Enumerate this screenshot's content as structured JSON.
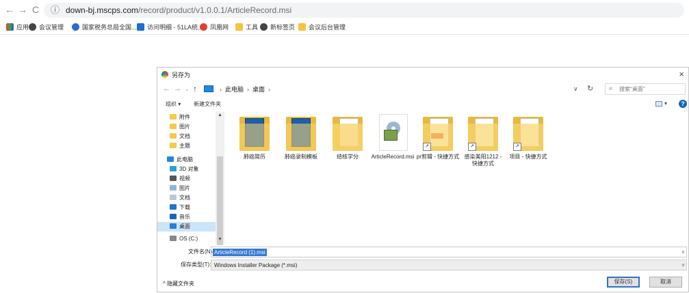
{
  "browser": {
    "back": "←",
    "forward": "→",
    "reload": "C",
    "info_icon": "ⓘ",
    "url_host": "down-bj.mscps.com",
    "url_path": "/record/product/v1.0.0.1/ArticleRecord.msi",
    "bookmarks": [
      {
        "label": "应用",
        "icon": "apps-icon"
      },
      {
        "label": "会议管理",
        "icon": "chrome-icon"
      },
      {
        "label": "国家税务总局全国...",
        "icon": "search-icon"
      },
      {
        "label": "访问明细 - 51LA统...",
        "icon": "analytics-icon"
      },
      {
        "label": "凤凰网",
        "icon": "phoenix-icon"
      },
      {
        "label": "工具",
        "icon": "folder-icon"
      },
      {
        "label": "新标签页",
        "icon": "chrome-icon"
      },
      {
        "label": "会议后台管理",
        "icon": "folder-icon"
      }
    ]
  },
  "dialog": {
    "title": "另存为",
    "close": "×",
    "path": {
      "root": "此电脑",
      "current": "桌面"
    },
    "search_placeholder": "搜索\"桌面\"",
    "toolbar": {
      "organize": "组织 ▾",
      "new_folder": "新建文件夹",
      "help": "?"
    },
    "nav": [
      {
        "label": "附件",
        "icon": "folder-icon"
      },
      {
        "label": "图片",
        "icon": "folder-icon"
      },
      {
        "label": "文档",
        "icon": "folder-icon"
      },
      {
        "label": "主题",
        "icon": "folder-icon"
      },
      {
        "label": "此电脑",
        "icon": "computer-icon"
      },
      {
        "label": "3D 对象",
        "icon": "cube-icon"
      },
      {
        "label": "视频",
        "icon": "video-icon"
      },
      {
        "label": "图片",
        "icon": "picture-icon"
      },
      {
        "label": "文档",
        "icon": "document-icon"
      },
      {
        "label": "下载",
        "icon": "download-icon"
      },
      {
        "label": "音乐",
        "icon": "music-icon"
      },
      {
        "label": "桌面",
        "icon": "desktop-icon",
        "selected": true
      },
      {
        "label": "OS (C:)",
        "icon": "drive-icon"
      }
    ],
    "files": [
      {
        "label": "肺癌简历",
        "type": "folder"
      },
      {
        "label": "肺癌录制模板",
        "type": "folder"
      },
      {
        "label": "结核学分",
        "type": "folder"
      },
      {
        "label": "ArticleRecord.msi",
        "type": "msi"
      },
      {
        "label": "pr剪辑 - 快捷方式",
        "type": "shortcut"
      },
      {
        "label": "感染美阳1212 - 快捷方式",
        "type": "shortcut"
      },
      {
        "label": "项目 - 快捷方式",
        "type": "shortcut"
      }
    ],
    "filename_label": "文件名(N):",
    "filename_value": "ArticleRecord (1).msi",
    "filetype_label": "保存类型(T):",
    "filetype_value": "Windows Installer Package (*.msi)",
    "hide_folders": "^ 隐藏文件夹",
    "save": "保存(S)",
    "cancel": "取消"
  }
}
